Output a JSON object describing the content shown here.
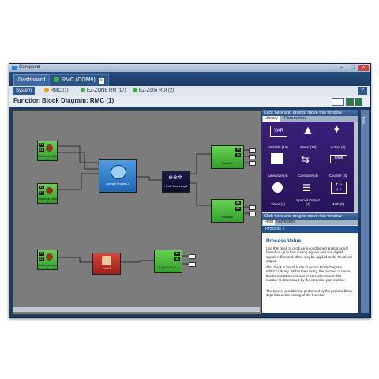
{
  "window": {
    "title": "Composer"
  },
  "tabs": [
    {
      "label": "Dashboard"
    },
    {
      "label": "RMC (COM9)"
    }
  ],
  "system_bar": {
    "items": [
      {
        "label": "System",
        "color": ""
      },
      {
        "label": "RMC (1)",
        "color": "#e8a21d"
      },
      {
        "label": "EZ-ZONE RM (17)",
        "color": "#3bb24a"
      },
      {
        "label": "EZ-Zone RUI (2)",
        "color": "#3bb24a"
      }
    ]
  },
  "diagram": {
    "title": "Function Block Diagram: RMC (1)",
    "blocks": {
      "input1": "Universal Input 1",
      "input2": "Universal Input 2",
      "input3": "Universal Input 3",
      "process": "Average Process 1",
      "loop": "Heat / Cool Loop 1",
      "output7": "Output 7",
      "output8": "Output 8",
      "limit": "Limit 1",
      "limit_output": "Limit Output 1"
    }
  },
  "right_panel": {
    "drag_hint": "Click here and drag to move this window",
    "lib_tabs": [
      "Library",
      "Parameters"
    ],
    "library": [
      {
        "label": "Variable (15)",
        "icon": "variable-icon"
      },
      {
        "label": "Alarm (16)",
        "icon": "alarm-icon"
      },
      {
        "label": "Action (8)",
        "icon": "action-icon"
      },
      {
        "label": "Linearize (4)",
        "icon": "linearize-icon"
      },
      {
        "label": "Compare (4)",
        "icon": "compare-icon"
      },
      {
        "label": "Counter (4)",
        "icon": "counter-icon"
      },
      {
        "label": "Timer (4)",
        "icon": "timer-icon"
      },
      {
        "label": "Special Output (4)",
        "icon": "special-output-icon"
      },
      {
        "label": "Math (8)",
        "icon": "math-icon"
      }
    ],
    "help_tabs": [
      "Help",
      "Navigator"
    ],
    "help": {
      "bar": "Process 1",
      "heading": "Process Value",
      "p1": "Use this block to produce a conditioned analog signal based on up to four analog signals and one digital signal. A filter and offset may be applied to the function's output.",
      "p2": "This block is found in the Function Block Diagram editor's Library. Within the Library, the number of these blocks available is shown in parenthesis and that number is determined by the controller part number.",
      "p3": "The type of conditioning performed by the process block depends on the setting of the Function"
    }
  },
  "side_strip_label": "Tools"
}
